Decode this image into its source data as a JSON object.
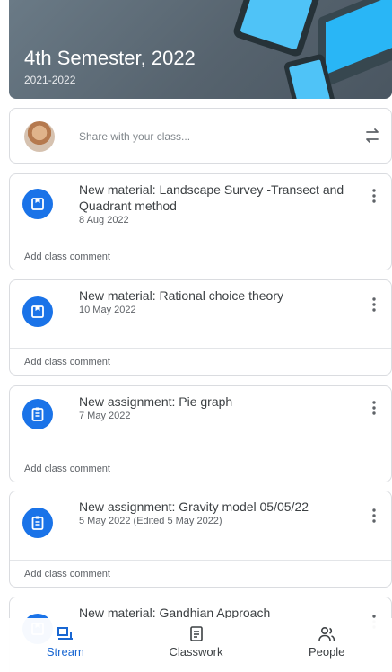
{
  "header": {
    "title": "4th Semester, 2022",
    "subtitle": "2021-2022"
  },
  "share": {
    "placeholder": "Share with your class..."
  },
  "stream": [
    {
      "type": "material",
      "title": "New material: Landscape Survey -Transect and Quadrant method",
      "date": "8 Aug 2022",
      "comment": "Add class comment"
    },
    {
      "type": "material",
      "title": "New material: Rational choice theory",
      "date": "10 May 2022",
      "comment": "Add class comment"
    },
    {
      "type": "assignment",
      "title": "New assignment: Pie graph",
      "date": "7 May 2022",
      "comment": "Add class comment"
    },
    {
      "type": "assignment",
      "title": "New assignment: Gravity model 05/05/22",
      "date": "5 May 2022 (Edited 5 May 2022)",
      "comment": "Add class comment"
    },
    {
      "type": "material",
      "title": "New material: Gandhian Approach",
      "date": "",
      "comment": ""
    }
  ],
  "nav": {
    "items": [
      {
        "label": "Stream",
        "icon": "stream-icon",
        "active": true
      },
      {
        "label": "Classwork",
        "icon": "classwork-icon",
        "active": false
      },
      {
        "label": "People",
        "icon": "people-icon",
        "active": false
      }
    ]
  },
  "colors": {
    "accent": "#1a73e8",
    "active_nav": "#1967d2",
    "banner": "#5f6b76"
  }
}
